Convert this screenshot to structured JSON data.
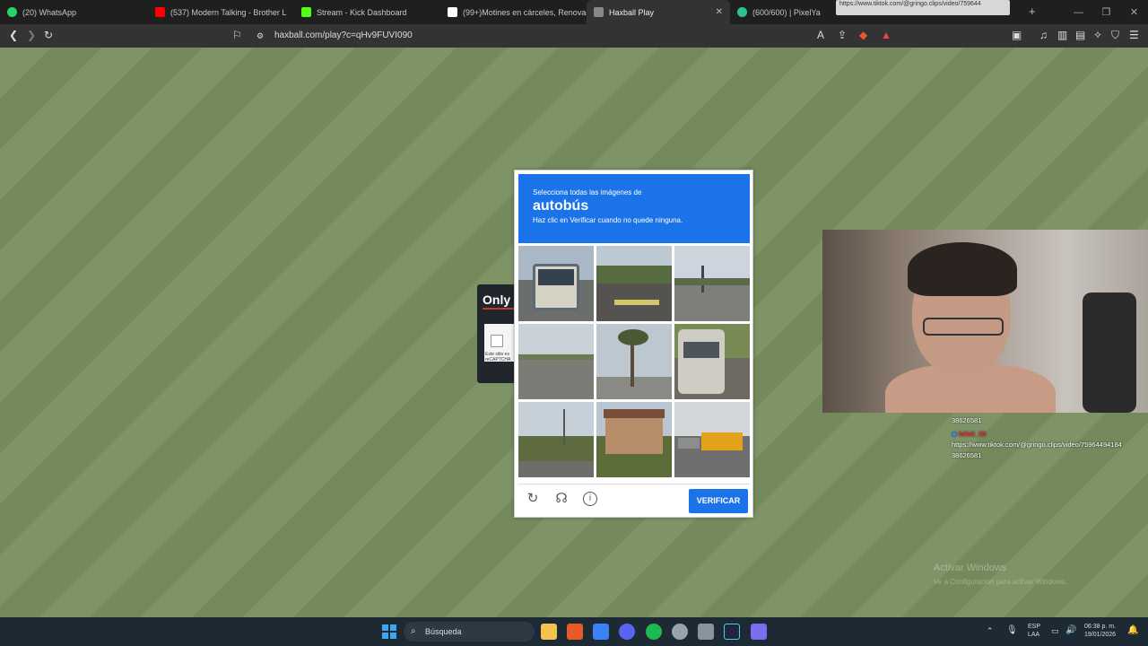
{
  "tabs": [
    {
      "label": "(20) WhatsApp",
      "color": "#25d366"
    },
    {
      "label": "(537) Modern Talking - Brother L",
      "color": "#ff0000"
    },
    {
      "label": "Stream - Kick Dashboard",
      "color": "#53fc18"
    },
    {
      "label": "(99+)Motines en cárceles, Renovació",
      "color": "#ffffff"
    },
    {
      "label": "Haxball Play",
      "color": "#888888"
    },
    {
      "label": "(600/600) | PixelYa",
      "color": "#2bc48a"
    }
  ],
  "active_tab_close": "✕",
  "new_tab": "+",
  "url_tooltip": "https://www.tiktok.com/@gringo.clips/video/759644",
  "address": "haxball.com/play?c=qHv9FUVI090",
  "side_panel": {
    "title": "Only",
    "recaptcha_text": "Este sitio es reCAPTCHA"
  },
  "captcha": {
    "instruction": "Selecciona todas las imágenes de",
    "target": "autobús",
    "hint": "Haz clic en Verificar cuando no quede ninguna.",
    "verify_label": "VERIFICAR",
    "tiles": [
      "bus",
      "road-crosswalk",
      "street-intersection",
      "highway",
      "palm-trees",
      "bus-rear",
      "street-palm",
      "building",
      "school-bus"
    ]
  },
  "chat": {
    "line1": "38626581",
    "user": "lofsit_25",
    "link": "https://www.tiktok.com/@gringo.clips/video/75964494184",
    "line2": "38626581"
  },
  "watermark": {
    "title": "Activar Windows",
    "subtitle": "Ve a Configuración para activar Windows."
  },
  "taskbar": {
    "search_label": "Búsqueda",
    "lang1": "ESP",
    "lang2": "LAA",
    "time": "06:38 p. m.",
    "date": "19/01/2026"
  }
}
